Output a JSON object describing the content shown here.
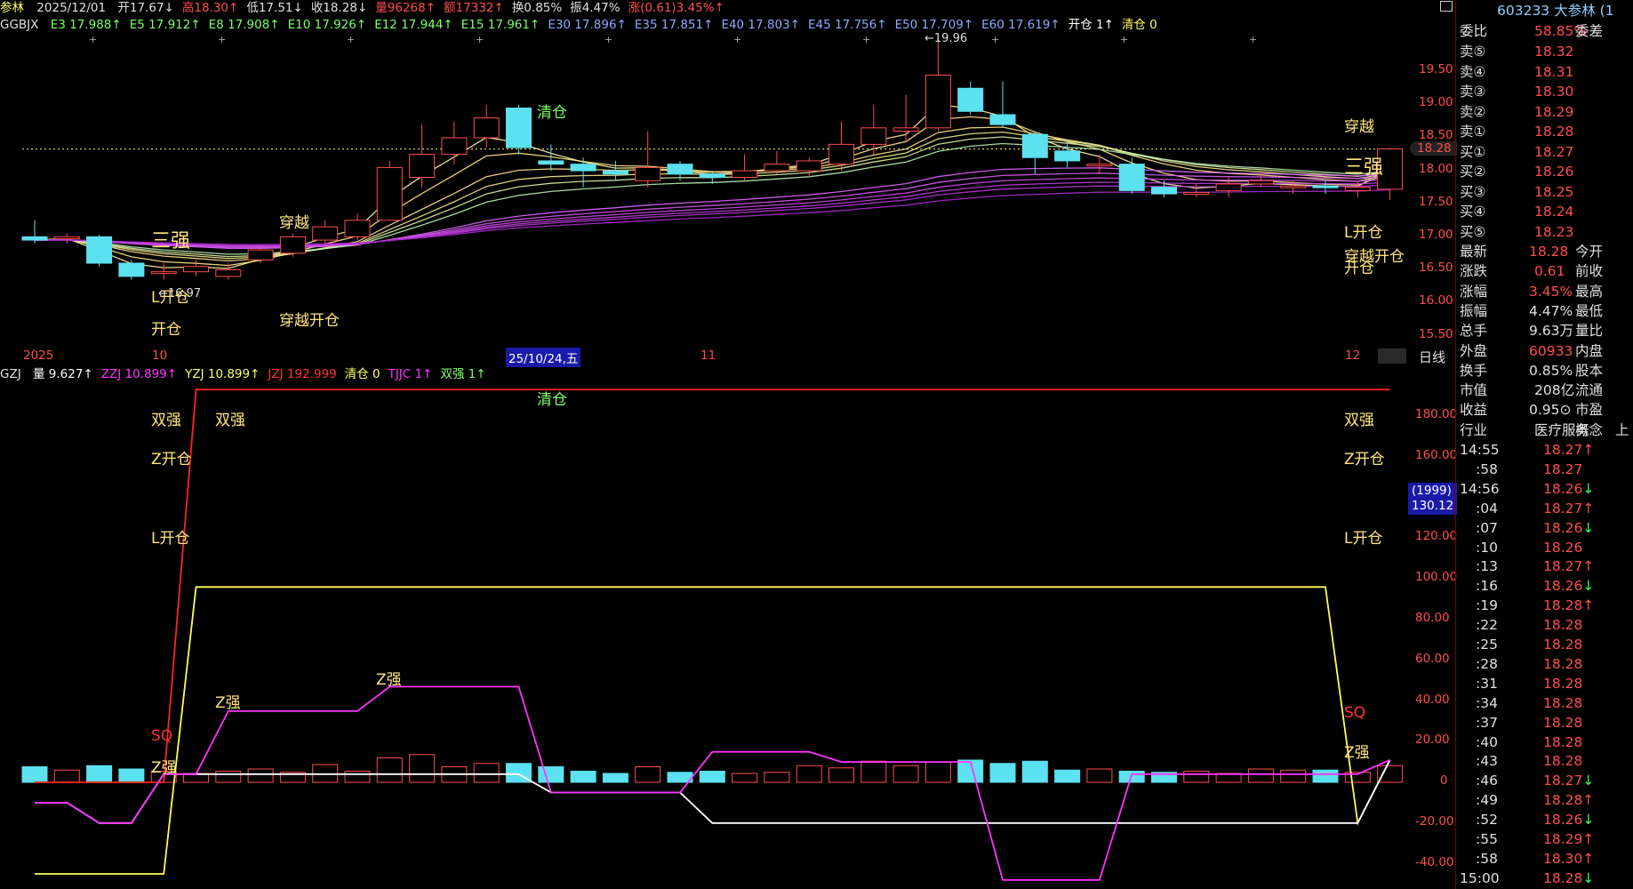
{
  "header": {
    "stock_short": "参林",
    "date": "2025/12/01",
    "items": [
      {
        "text": "开17.67↓",
        "color": "#e0e0e0"
      },
      {
        "text": "高18.30↑",
        "color": "#ff4d4d"
      },
      {
        "text": "低17.51↓",
        "color": "#e0e0e0"
      },
      {
        "text": "收18.28↓",
        "color": "#e0e0e0"
      },
      {
        "text": "量96268↑",
        "color": "#ff4d4d"
      },
      {
        "text": "额17332↑",
        "color": "#ff4d4d"
      },
      {
        "text": "换0.85%",
        "color": "#e0e0e0"
      },
      {
        "text": "振4.47%",
        "color": "#e0e0e0"
      },
      {
        "text": "涨(0.61)3.45%↑",
        "color": "#ff4d4d"
      }
    ]
  },
  "indicator_main": {
    "name": "GGBJX",
    "items": [
      {
        "text": "E3 17.988↑",
        "color": "#7dff6b"
      },
      {
        "text": "E5 17.912↑",
        "color": "#7dff6b"
      },
      {
        "text": "E8 17.908↑",
        "color": "#7dff6b"
      },
      {
        "text": "E10 17.926↑",
        "color": "#7dff6b"
      },
      {
        "text": "E12 17.944↑",
        "color": "#7dff6b"
      },
      {
        "text": "E15 17.961↑",
        "color": "#7dff6b"
      },
      {
        "text": "E30 17.896↑",
        "color": "#8fa8ff"
      },
      {
        "text": "E35 17.851↑",
        "color": "#8fa8ff"
      },
      {
        "text": "E40 17.803↑",
        "color": "#8fa8ff"
      },
      {
        "text": "E45 17.756↑",
        "color": "#8fa8ff"
      },
      {
        "text": "E50 17.709↑",
        "color": "#8fa8ff"
      },
      {
        "text": "E60 17.619↑",
        "color": "#8fa8ff"
      },
      {
        "text": "开仓 1↑",
        "color": "#ffffff"
      },
      {
        "text": "清仓 0",
        "color": "#ffff66"
      }
    ]
  },
  "indicator_sub": {
    "name": "GZJ",
    "items": [
      {
        "text": "量 9.627↑",
        "color": "#ffffff"
      },
      {
        "text": "ZZJ 10.899↑",
        "color": "#ff33ff"
      },
      {
        "text": "YZJ 10.899↑",
        "color": "#ffff66"
      },
      {
        "text": "JZJ 192.999",
        "color": "#ff3333"
      },
      {
        "text": "清仓 0",
        "color": "#ffff66"
      },
      {
        "text": "TJJC 1↑",
        "color": "#ff33ff"
      },
      {
        "text": "双强 1↑",
        "color": "#7dff6b"
      }
    ]
  },
  "price_axis": [
    "19.50",
    "19.00",
    "18.50",
    "18.00",
    "17.50",
    "17.00",
    "16.50",
    "16.00",
    "15.50"
  ],
  "sub_axis": [
    "180.00",
    "160.00",
    "140.00",
    "120.00",
    "100.00",
    "80.00",
    "60.00",
    "40.00",
    "20.00",
    "0",
    "-20.00",
    "-40.00"
  ],
  "date_axis": {
    "year": "2025",
    "m10": "10",
    "m11": "11",
    "m12": "12",
    "cursor_date": "25/10/24,五",
    "period": "日线"
  },
  "markers": {
    "high_label": "19.96",
    "low_label": "16.97",
    "price_tag": "18.28",
    "cursor_box_top": "(1999)",
    "cursor_box_bottom": "130.12"
  },
  "signals_top": {
    "sanqiang_left": "三强",
    "sanqiang_right": "三强",
    "chuanyue_a": "穿越",
    "chuanyue_right": "穿越",
    "chuanyue_kaicang": "穿越开仓",
    "qingcang": "清仓",
    "l_kaicang_a": "L开仓",
    "kaicang_a": "开仓",
    "l_kaicang_r": "L开仓",
    "chuanyue_kaicang_r": "穿越开仓",
    "kaicang_r": "开仓"
  },
  "signals_sub": {
    "qingcang": "清仓",
    "shuangqiang1": "双强",
    "shuangqiang2": "双强",
    "z_kaicang": "Z开仓",
    "l_kaicang": "L开仓",
    "sq": "SQ",
    "zqiang_a": "Z强",
    "zqiang_b": "Z强",
    "zqiang_c": "Z强",
    "shuangqiang_r": "双强",
    "z_kaicang_r": "Z开仓",
    "l_kaicang_r": "L开仓",
    "sq_r": "SQ",
    "zqiang_r": "Z强"
  },
  "right_panel": {
    "code": "603233",
    "name": "大参林",
    "suffix": "(1",
    "weibi_label": "委比",
    "weibi_value": "58.85%",
    "weicha_label": "委差",
    "sell": [
      {
        "label": "卖⑤",
        "price": "18.32"
      },
      {
        "label": "卖④",
        "price": "18.31"
      },
      {
        "label": "卖③",
        "price": "18.30"
      },
      {
        "label": "卖②",
        "price": "18.29"
      },
      {
        "label": "卖①",
        "price": "18.28"
      }
    ],
    "buy": [
      {
        "label": "买①",
        "price": "18.27"
      },
      {
        "label": "买②",
        "price": "18.26"
      },
      {
        "label": "买③",
        "price": "18.25"
      },
      {
        "label": "买④",
        "price": "18.24"
      },
      {
        "label": "买⑤",
        "price": "18.23"
      }
    ],
    "stats": [
      {
        "l": "最新",
        "v": "18.28",
        "r": "今开",
        "vc": "#ff4d4d"
      },
      {
        "l": "涨跌",
        "v": "0.61",
        "r": "前收",
        "vc": "#ff4d4d"
      },
      {
        "l": "涨幅",
        "v": "3.45%",
        "r": "最高",
        "vc": "#ff4d4d"
      },
      {
        "l": "振幅",
        "v": "4.47%",
        "r": "最低",
        "vc": "#e0e0e0"
      },
      {
        "l": "总手",
        "v": "9.63万",
        "r": "量比",
        "vc": "#e0e0e0"
      },
      {
        "l": "外盘",
        "v": "60933",
        "r": "内盘",
        "vc": "#ff4d4d"
      },
      {
        "l": "换手",
        "v": "0.85%",
        "r": "股本",
        "vc": "#e0e0e0"
      },
      {
        "l": "市值",
        "v": "208亿",
        "r": "流通",
        "vc": "#e0e0e0"
      },
      {
        "l": "收益",
        "v": "0.95⊙",
        "r": "市盈",
        "vc": "#e0e0e0"
      },
      {
        "l": "行业",
        "v": "医疗服务",
        "r": "概念",
        "vc": "#e0e0e0"
      }
    ],
    "concept_extra": "上",
    "ticks": [
      {
        "t": "14:55",
        "p": "18.27↑",
        "c": "#ff4d4d"
      },
      {
        "t": ":58",
        "p": "18.27",
        "c": "#ff4d4d"
      },
      {
        "t": "14:56",
        "p": "18.26↓",
        "c": "#ff4d4d"
      },
      {
        "t": ":04",
        "p": "18.27↑",
        "c": "#ff4d4d"
      },
      {
        "t": ":07",
        "p": "18.26↓",
        "c": "#ff4d4d"
      },
      {
        "t": ":10",
        "p": "18.26",
        "c": "#ff4d4d"
      },
      {
        "t": ":13",
        "p": "18.27↑",
        "c": "#ff4d4d"
      },
      {
        "t": ":16",
        "p": "18.26↓",
        "c": "#ff4d4d"
      },
      {
        "t": ":19",
        "p": "18.28↑",
        "c": "#ff4d4d"
      },
      {
        "t": ":22",
        "p": "18.28",
        "c": "#ff4d4d"
      },
      {
        "t": ":25",
        "p": "18.28",
        "c": "#ff4d4d"
      },
      {
        "t": ":28",
        "p": "18.28",
        "c": "#ff4d4d"
      },
      {
        "t": ":31",
        "p": "18.28",
        "c": "#ff4d4d"
      },
      {
        "t": ":34",
        "p": "18.28",
        "c": "#ff4d4d"
      },
      {
        "t": ":37",
        "p": "18.28",
        "c": "#ff4d4d"
      },
      {
        "t": ":40",
        "p": "18.28",
        "c": "#ff4d4d"
      },
      {
        "t": ":43",
        "p": "18.28",
        "c": "#ff4d4d"
      },
      {
        "t": ":46",
        "p": "18.27↓",
        "c": "#ff4d4d"
      },
      {
        "t": ":49",
        "p": "18.28↑",
        "c": "#ff4d4d"
      },
      {
        "t": ":52",
        "p": "18.26↓",
        "c": "#ff4d4d"
      },
      {
        "t": ":55",
        "p": "18.29↑",
        "c": "#ff4d4d"
      },
      {
        "t": ":58",
        "p": "18.30↑",
        "c": "#ff4d4d"
      },
      {
        "t": "15:00",
        "p": "18.28↓",
        "c": "#ff4d4d"
      }
    ]
  },
  "chart_data": {
    "type": "candlestick",
    "ylim": [
      15.3,
      20.0
    ],
    "series_ma": [
      "E3",
      "E5",
      "E8",
      "E10",
      "E12",
      "E15",
      "E30",
      "E35",
      "E40",
      "E45",
      "E50",
      "E60"
    ],
    "candles": [
      [
        16.95,
        16.9,
        17.2,
        16.85
      ],
      [
        16.92,
        16.95,
        17.0,
        16.85
      ],
      [
        16.95,
        16.55,
        16.98,
        16.5
      ],
      [
        16.55,
        16.35,
        16.6,
        16.3
      ],
      [
        16.4,
        16.42,
        16.55,
        16.3
      ],
      [
        16.42,
        16.5,
        16.6,
        16.35
      ],
      [
        16.35,
        16.45,
        16.55,
        16.3
      ],
      [
        16.6,
        16.75,
        16.8,
        16.55
      ],
      [
        16.7,
        16.95,
        17.0,
        16.65
      ],
      [
        16.9,
        17.1,
        17.2,
        16.85
      ],
      [
        16.95,
        17.2,
        17.3,
        16.9
      ],
      [
        17.2,
        18.0,
        18.1,
        17.2
      ],
      [
        17.85,
        18.2,
        18.65,
        17.7
      ],
      [
        18.2,
        18.45,
        18.7,
        18.05
      ],
      [
        18.45,
        18.75,
        18.95,
        18.3
      ],
      [
        18.9,
        18.3,
        18.95,
        18.2
      ],
      [
        18.1,
        18.05,
        18.35,
        17.95
      ],
      [
        18.05,
        17.95,
        18.15,
        17.7
      ],
      [
        17.95,
        17.9,
        18.1,
        17.8
      ],
      [
        17.8,
        18.0,
        18.55,
        17.7
      ],
      [
        18.05,
        17.9,
        18.1,
        17.8
      ],
      [
        17.9,
        17.85,
        17.95,
        17.75
      ],
      [
        17.85,
        17.95,
        18.2,
        17.8
      ],
      [
        17.95,
        18.05,
        18.25,
        17.9
      ],
      [
        17.95,
        18.1,
        18.15,
        17.85
      ],
      [
        18.05,
        18.35,
        18.7,
        17.95
      ],
      [
        18.35,
        18.6,
        18.95,
        18.2
      ],
      [
        18.55,
        18.6,
        19.1,
        18.4
      ],
      [
        18.6,
        19.4,
        19.96,
        18.55
      ],
      [
        19.2,
        18.85,
        19.3,
        18.8
      ],
      [
        18.8,
        18.65,
        19.3,
        18.6
      ],
      [
        18.5,
        18.15,
        18.55,
        17.9
      ],
      [
        18.25,
        18.1,
        18.4,
        18.0
      ],
      [
        18.05,
        18.05,
        18.2,
        17.9
      ],
      [
        18.05,
        17.65,
        18.15,
        17.6
      ],
      [
        17.7,
        17.6,
        17.8,
        17.55
      ],
      [
        17.6,
        17.62,
        17.75,
        17.55
      ],
      [
        17.65,
        17.75,
        17.85,
        17.55
      ],
      [
        17.75,
        17.8,
        17.95,
        17.7
      ],
      [
        17.7,
        17.72,
        17.8,
        17.6
      ],
      [
        17.72,
        17.7,
        17.8,
        17.6
      ],
      [
        17.65,
        17.7,
        17.78,
        17.55
      ],
      [
        17.67,
        18.28,
        18.3,
        17.51
      ]
    ],
    "volume": [
      14,
      11,
      15,
      12,
      10,
      8,
      10,
      12,
      9,
      16,
      10,
      22,
      25,
      14,
      17,
      17,
      14,
      10,
      8,
      14,
      9,
      10,
      8,
      9,
      15,
      13,
      19,
      15,
      18,
      20,
      17,
      19,
      11,
      12,
      10,
      9,
      10,
      8,
      12,
      11,
      11,
      9,
      15
    ],
    "JZJ": [
      0,
      0,
      0,
      0,
      0,
      193,
      193,
      193,
      193,
      193,
      193,
      193,
      193,
      193,
      193,
      193,
      193,
      193,
      193,
      193,
      193,
      193,
      193,
      193,
      193,
      193,
      193,
      193,
      193,
      193,
      193,
      193,
      193,
      193,
      193,
      193,
      193,
      193,
      193,
      193,
      193,
      193,
      193
    ],
    "YZJ": [
      -45,
      -45,
      -45,
      -45,
      -45,
      96,
      96,
      96,
      96,
      96,
      96,
      96,
      96,
      96,
      96,
      96,
      96,
      96,
      96,
      96,
      96,
      96,
      96,
      96,
      96,
      96,
      96,
      96,
      96,
      96,
      96,
      96,
      96,
      96,
      96,
      96,
      96,
      96,
      96,
      96,
      96,
      -20,
      11
    ],
    "ZZJ": [
      -10,
      -10,
      -20,
      -20,
      4,
      4,
      35,
      35,
      35,
      35,
      35,
      47,
      47,
      47,
      47,
      47,
      -5,
      -5,
      -5,
      -5,
      -5,
      15,
      15,
      15,
      15,
      10,
      10,
      10,
      10,
      10,
      -48,
      -48,
      -48,
      -48,
      4,
      4,
      4,
      4,
      4,
      4,
      4,
      4,
      11
    ],
    "WL": [
      -10,
      -10,
      -20,
      -20,
      4,
      4,
      4,
      4,
      4,
      4,
      4,
      4,
      4,
      4,
      4,
      4,
      -5,
      -5,
      -5,
      -5,
      -5,
      -20,
      -20,
      -20,
      -20,
      -20,
      -20,
      -20,
      -20,
      -20,
      -20,
      -20,
      -20,
      -20,
      -20,
      -20,
      -20,
      -20,
      -20,
      -20,
      -20,
      -20,
      11
    ]
  }
}
